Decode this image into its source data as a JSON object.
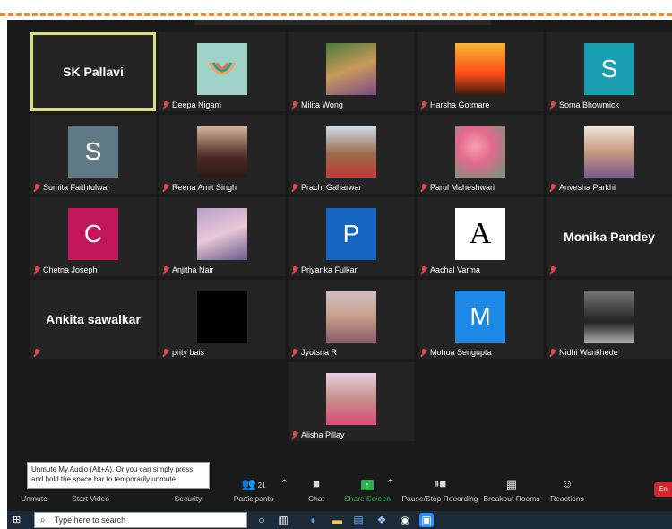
{
  "participants": [
    {
      "name": "SK Pallavi",
      "display": "name",
      "active": true
    },
    {
      "name": "Deepa Nigam",
      "display": "image",
      "image": "rainbow-smile",
      "muted": true
    },
    {
      "name": "Milita Wong",
      "display": "image",
      "image": "photo-woman-garden",
      "muted": true
    },
    {
      "name": "Harsha Gotmare",
      "display": "image",
      "image": "sunset-palm",
      "muted": true
    },
    {
      "name": "Soma Bhowmick",
      "display": "letter",
      "letter": "S",
      "color": "#1a9fb0",
      "muted": true
    },
    {
      "name": "Sumita Faithfulwar",
      "display": "letter",
      "letter": "S",
      "color": "#5f7a86",
      "muted": true
    },
    {
      "name": "Reena Amit Singh",
      "display": "image",
      "image": "photo-woman",
      "muted": true
    },
    {
      "name": "Prachi Gaharwar",
      "display": "image",
      "image": "photo-woman-fort",
      "muted": true
    },
    {
      "name": "Parul Maheshwari",
      "display": "image",
      "image": "pink-flowers",
      "muted": true
    },
    {
      "name": "Anvesha Parkhi",
      "display": "image",
      "image": "photo-woman-portrait",
      "muted": true
    },
    {
      "name": "Chetna Joseph",
      "display": "letter",
      "letter": "C",
      "color": "#c2185b",
      "muted": true
    },
    {
      "name": "Anjitha Nair",
      "display": "image",
      "image": "purple-flowers",
      "muted": true
    },
    {
      "name": "Priyanka Fulkari",
      "display": "letter",
      "letter": "P",
      "color": "#1565c0",
      "muted": true
    },
    {
      "name": "Aachal Varma",
      "display": "letter",
      "letter": "A",
      "color": "#ffffff",
      "textcolor": "#000000",
      "muted": true
    },
    {
      "name": "Monika Pandey",
      "display": "name",
      "muted": true
    },
    {
      "name": "Ankita sawalkar",
      "display": "name",
      "muted": true
    },
    {
      "name": "prity bais",
      "display": "image",
      "image": "black",
      "muted": true
    },
    {
      "name": "Jyotsna R",
      "display": "image",
      "image": "photo-woman-glasses",
      "muted": true
    },
    {
      "name": "Mohua Sengupta",
      "display": "letter",
      "letter": "M",
      "color": "#1e88e5",
      "muted": true
    },
    {
      "name": "Nidhi Wankhede",
      "display": "image",
      "image": "photo-woman-bw",
      "muted": true
    },
    {
      "name": "Alisha Pillay",
      "display": "image",
      "image": "photo-woman-flowers",
      "muted": true
    }
  ],
  "tooltip": {
    "text": "Unmute My Audio (Alt+A). Or you can simply press and hold the space bar to temporarily unmute."
  },
  "toolbar": {
    "unmute": "Unmute",
    "start_video": "Start Video",
    "security": "Security",
    "participants": "Participants",
    "participant_count": "21",
    "chat": "Chat",
    "share_screen": "Share Screen",
    "record": "Pause/Stop Recording",
    "breakout": "Breakout Rooms",
    "reactions": "Reactions",
    "end": "En"
  },
  "taskbar": {
    "search_placeholder": "Type here to search"
  }
}
